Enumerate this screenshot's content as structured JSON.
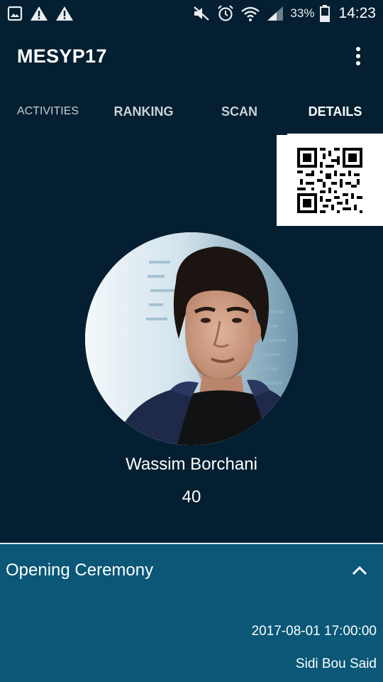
{
  "status_bar": {
    "battery_percent": "33%",
    "time": "14:23",
    "icons": [
      "image-icon",
      "warning-icon",
      "warning-icon",
      "mute-icon",
      "alarm-icon",
      "wifi-icon",
      "signal-icon",
      "battery-icon"
    ]
  },
  "app_bar": {
    "title": "MESYP17",
    "menu_icon": "more-vert-icon"
  },
  "tabs": [
    {
      "label": "ACTIVITIES",
      "active": false
    },
    {
      "label": "RANKING",
      "active": false
    },
    {
      "label": "SCAN",
      "active": false
    },
    {
      "label": "DETAILS",
      "active": true
    }
  ],
  "profile": {
    "name": "Wassim Borchani",
    "score": "40",
    "avatar_icon": "avatar-photo",
    "qr_icon": "qr-code-icon"
  },
  "event": {
    "title": "Opening Ceremony",
    "datetime": "2017-08-01 17:00:00",
    "location": "Sidi Bou Said",
    "toggle_icon": "chevron-up-icon"
  },
  "colors": {
    "background": "#041f31",
    "card": "#0a5778",
    "text": "#ffffff"
  }
}
